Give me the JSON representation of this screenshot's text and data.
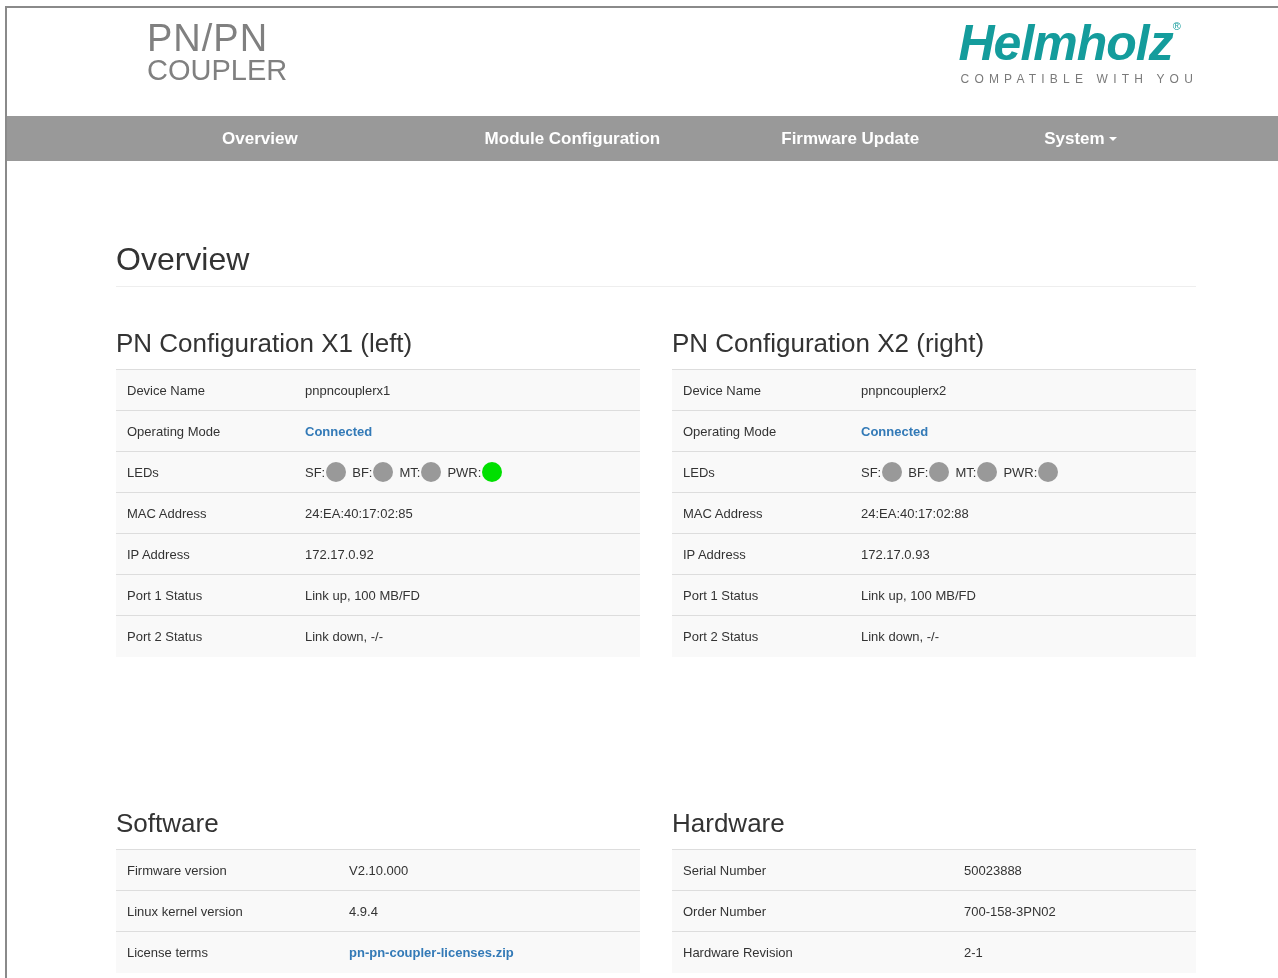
{
  "logo": {
    "line_1": "PN/PN",
    "line_2": "COUPLER"
  },
  "brand": {
    "name": "Helmholz",
    "mark": "®",
    "tagline": "COMPATIBLE WITH YOU"
  },
  "nav": [
    {
      "label": "Overview",
      "dropdown": false
    },
    {
      "label": "Module Configuration",
      "dropdown": false
    },
    {
      "label": "Firmware Update",
      "dropdown": false
    },
    {
      "label": "System",
      "dropdown": true
    }
  ],
  "page_title": "Overview",
  "sections": [
    {
      "title": "PN Configuration X1 (left)",
      "rows": [
        {
          "kind": "text",
          "label": "Device Name",
          "value": "pnpncouplerx1"
        },
        {
          "kind": "link",
          "label": "Operating Mode",
          "value": "Connected"
        },
        {
          "kind": "leds",
          "label": "LEDs",
          "leds": [
            {
              "name": "SF:",
              "on": false
            },
            {
              "name": "BF:",
              "on": false
            },
            {
              "name": "MT:",
              "on": false
            },
            {
              "name": "PWR:",
              "on": true
            }
          ]
        },
        {
          "kind": "text",
          "label": "MAC Address",
          "value": "24:EA:40:17:02:85"
        },
        {
          "kind": "text",
          "label": "IP Address",
          "value": "172.17.0.92"
        },
        {
          "kind": "text",
          "label": "Port 1 Status",
          "value": "Link up, 100 MB/FD"
        },
        {
          "kind": "text",
          "label": "Port 2 Status",
          "value": "Link down, -/-"
        }
      ]
    },
    {
      "title": "PN Configuration X2 (right)",
      "rows": [
        {
          "kind": "text",
          "label": "Device Name",
          "value": "pnpncouplerx2"
        },
        {
          "kind": "link",
          "label": "Operating Mode",
          "value": "Connected"
        },
        {
          "kind": "leds",
          "label": "LEDs",
          "leds": [
            {
              "name": "SF:",
              "on": false
            },
            {
              "name": "BF:",
              "on": false
            },
            {
              "name": "MT:",
              "on": false
            },
            {
              "name": "PWR:",
              "on": false
            }
          ]
        },
        {
          "kind": "text",
          "label": "MAC Address",
          "value": "24:EA:40:17:02:88"
        },
        {
          "kind": "text",
          "label": "IP Address",
          "value": "172.17.0.93"
        },
        {
          "kind": "text",
          "label": "Port 1 Status",
          "value": "Link up, 100 MB/FD"
        },
        {
          "kind": "text",
          "label": "Port 2 Status",
          "value": "Link down, -/-"
        }
      ]
    },
    {
      "title": "Software",
      "rows": [
        {
          "kind": "text",
          "label": "Firmware version",
          "value": "V2.10.000"
        },
        {
          "kind": "text",
          "label": "Linux kernel version",
          "value": "4.9.4"
        },
        {
          "kind": "link",
          "label": "License terms",
          "value": "pn-pn-coupler-licenses.zip"
        }
      ]
    },
    {
      "title": "Hardware",
      "rows": [
        {
          "kind": "text",
          "label": "Serial Number",
          "value": "50023888"
        },
        {
          "kind": "text",
          "label": "Order Number",
          "value": "700-158-3PN02"
        },
        {
          "kind": "text",
          "label": "Hardware Revision",
          "value": "2-1"
        }
      ]
    }
  ]
}
